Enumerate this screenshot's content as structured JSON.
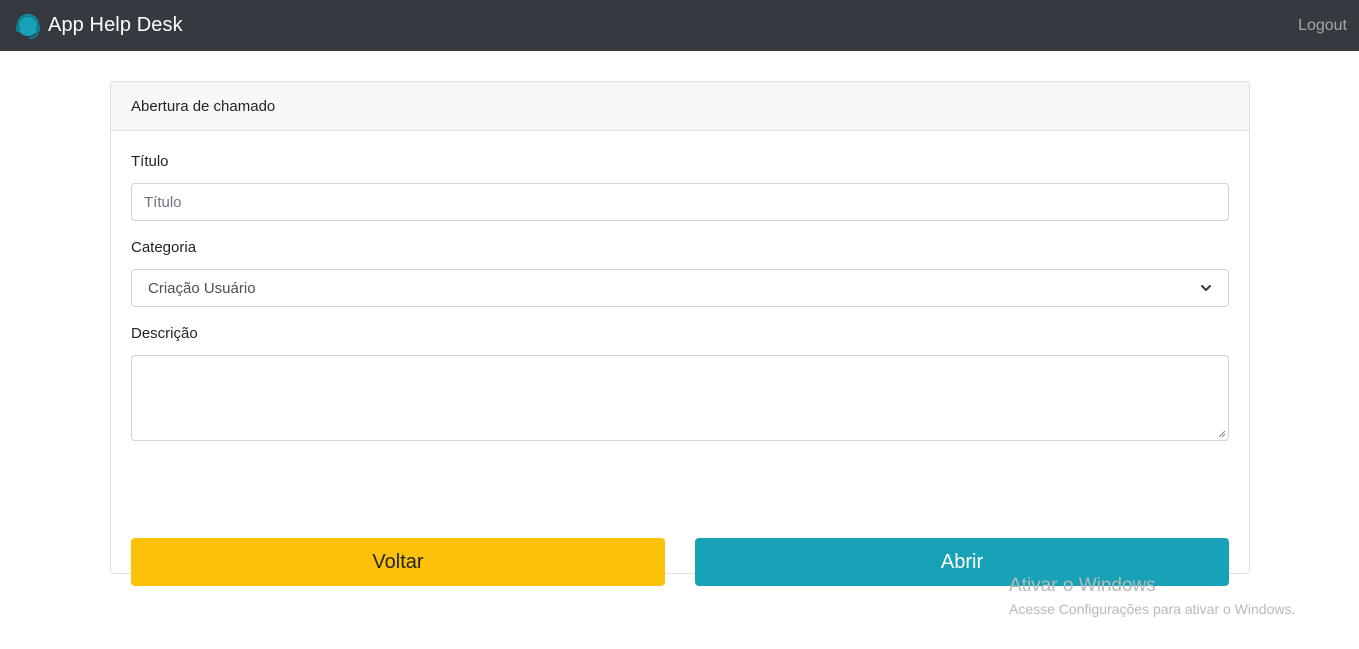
{
  "navbar": {
    "brand": "App Help Desk",
    "logo_icon": "headset-icon",
    "logout": "Logout",
    "colors": {
      "background": "#343a40",
      "logo": "#17a2b8"
    }
  },
  "card": {
    "header": "Abertura de chamado",
    "fields": {
      "titulo": {
        "label": "Título",
        "placeholder": "Título",
        "value": ""
      },
      "categoria": {
        "label": "Categoria",
        "selected": "Criação Usuário",
        "icon": "chevron-down-icon"
      },
      "descricao": {
        "label": "Descrição",
        "value": ""
      }
    },
    "buttons": {
      "voltar": {
        "label": "Voltar",
        "color": "#fcc108"
      },
      "abrir": {
        "label": "Abrir",
        "color": "#17a2b8"
      }
    }
  },
  "watermark": {
    "title": "Ativar o Windows",
    "subtitle": "Acesse Configurações para ativar o Windows."
  }
}
